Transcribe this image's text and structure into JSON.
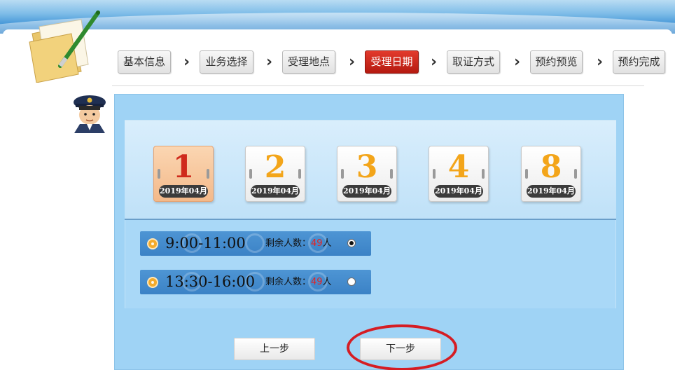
{
  "steps": [
    {
      "label": "基本信息",
      "active": false
    },
    {
      "label": "业务选择",
      "active": false
    },
    {
      "label": "受理地点",
      "active": false
    },
    {
      "label": "受理日期",
      "active": true
    },
    {
      "label": "取证方式",
      "active": false
    },
    {
      "label": "预约预览",
      "active": false
    },
    {
      "label": "预约完成",
      "active": false
    }
  ],
  "dates": [
    {
      "day": "1",
      "month": "2019年04月",
      "selected": true
    },
    {
      "day": "2",
      "month": "2019年04月",
      "selected": false
    },
    {
      "day": "3",
      "month": "2019年04月",
      "selected": false
    },
    {
      "day": "4",
      "month": "2019年04月",
      "selected": false
    },
    {
      "day": "8",
      "month": "2019年04月",
      "selected": false
    }
  ],
  "slots": [
    {
      "time": "9:00-11:00",
      "remain_label": "剩余人数：",
      "remain_count": "49",
      "remain_unit": "人",
      "checked": true
    },
    {
      "time": "13:30-16:00",
      "remain_label": "剩余人数：",
      "remain_count": "49",
      "remain_unit": "人",
      "checked": false
    }
  ],
  "buttons": {
    "prev": "上一步",
    "next": "下一步"
  },
  "colors": {
    "active_step": "#c8201a",
    "panel_blue": "#9fd3f5",
    "slot_blue": "#3f86c8",
    "day_orange": "#f3a51a",
    "day_selected_red": "#cf2a1c",
    "highlight_ring": "#d51d24"
  }
}
